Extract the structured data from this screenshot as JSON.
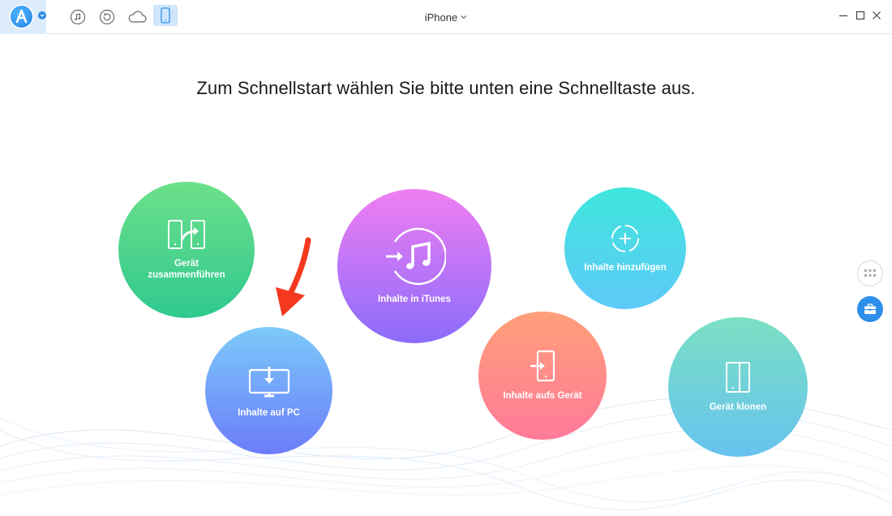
{
  "titlebar": {
    "device_name": "iPhone",
    "tools": [
      "music-note-icon",
      "restore-icon",
      "cloud-icon",
      "phone-icon"
    ],
    "active_tool": "phone-icon"
  },
  "heading": "Zum Schnellstart wählen Sie bitte unten eine Schnelltaste aus.",
  "actions": {
    "merge": "Gerät\nzusammenführen",
    "itunes": "Inhalte in iTunes",
    "add": "Inhalte hinzufügen",
    "pc": "Inhalte auf PC",
    "to_device": "Inhalte aufs Gerät",
    "clone": "Gerät klonen"
  },
  "colors": {
    "accent": "#2d8fe9",
    "merge": "#3fd08c",
    "itunes": "#c374f5",
    "add": "#4ed8e8",
    "pc": "#7496fa",
    "to_device": "#ff8c89",
    "clone": "#72d2d8",
    "annotation_arrow": "#f4391f"
  }
}
